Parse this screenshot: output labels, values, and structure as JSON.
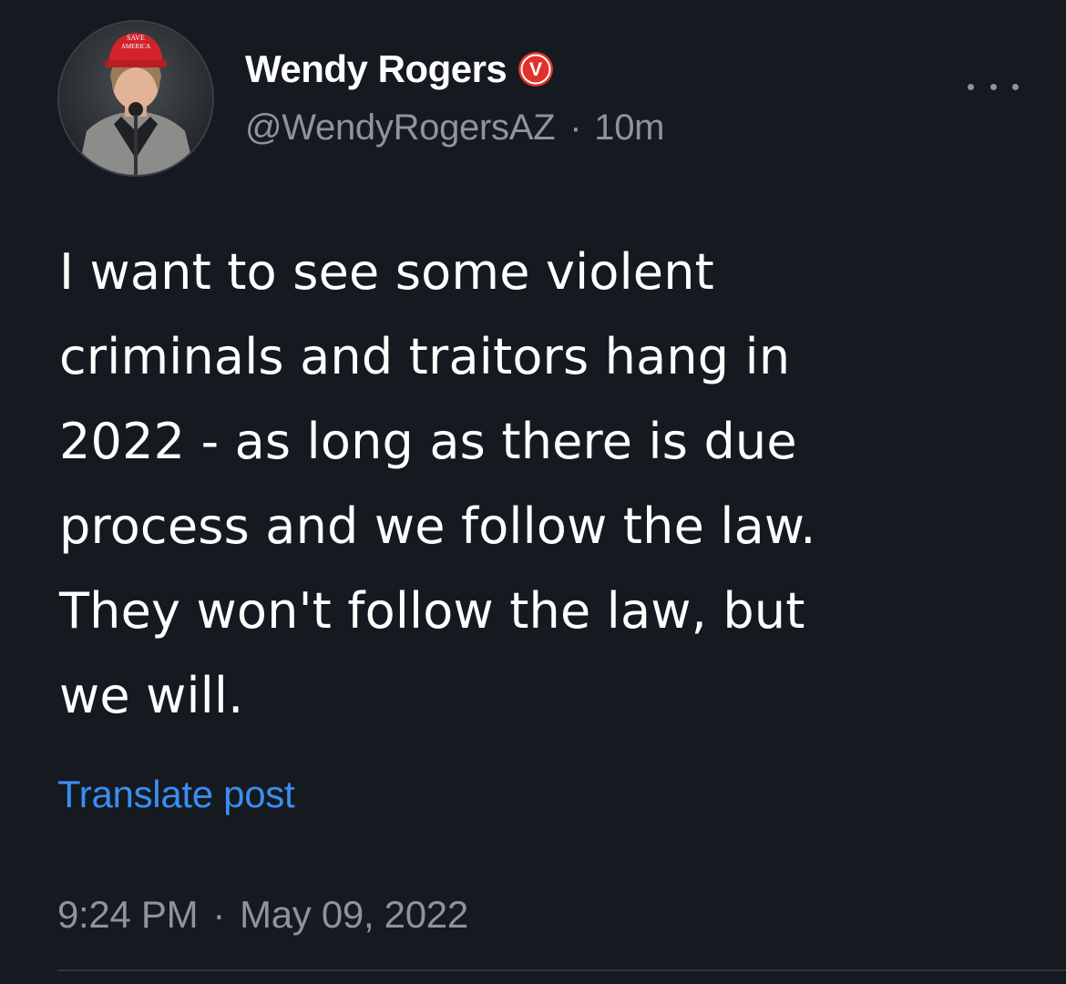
{
  "author": {
    "display_name": "Wendy Rogers",
    "handle": "@WendyRogersAZ",
    "relative_time": "10m",
    "separator": "·",
    "verified_badge_letter": "V",
    "hat_text_line1": "SAVE",
    "hat_text_line2": "AMERICA"
  },
  "tweet": {
    "lines": [
      "I want to see some violent",
      "criminals and traitors hang in",
      "2022 - as long as there is due",
      "process and we follow the law.",
      "They won't follow the law, but",
      "we will."
    ]
  },
  "actions": {
    "translate_label": "Translate post"
  },
  "meta": {
    "time": "9:24 PM",
    "separator": "·",
    "date": "May 09, 2022"
  },
  "colors": {
    "background": "#151920",
    "link": "#3a8ef0",
    "secondary_text": "#8d949e",
    "badge_red": "#e0322b"
  }
}
